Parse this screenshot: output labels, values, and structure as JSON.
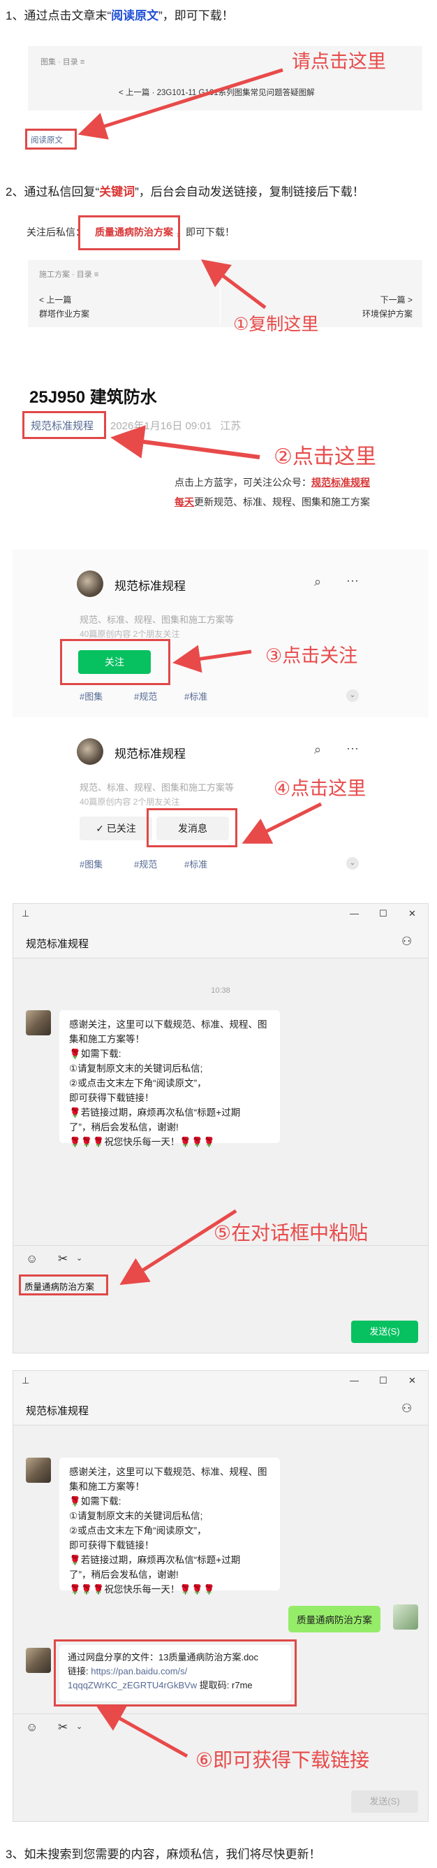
{
  "step1": {
    "prefix": "1、通过点击文章末“",
    "highlight": "阅读原文",
    "suffix": "”，即可下载！"
  },
  "article_footer": {
    "breadcrumb": "图集 · 目录 ≡",
    "prev_label": "< 上一篇 · 23G101-11  G101系列图集常见问题答疑图解",
    "read_original": "阅读原文",
    "callout": "请点击这里"
  },
  "step2": {
    "prefix": "2、通过私信回复“",
    "highlight": "关键词",
    "suffix": "”，后台会自动发送链接，复制链接后下载！"
  },
  "keyword_line": {
    "prefix": "关注后私信：",
    "keyword": "质量通病防治方案",
    "suffix": "，即可下载！"
  },
  "nav_panel": {
    "breadcrumb": "施工方案 · 目录 ≡",
    "prev_label": "< 上一篇",
    "prev_title": "群塔作业方案",
    "next_label": "下一篇 >",
    "next_title": "环境保护方案",
    "callout": "①复制这里"
  },
  "article_header": {
    "title": "25J950 建筑防水",
    "account": "规范标准规程",
    "date": "2026年1月16日 09:01",
    "location": "江苏",
    "callout": "②点击这里",
    "promo_line1_prefix": "点击上方蓝字，可关注公众号：",
    "promo_line1_link": "规范标准规程",
    "promo_line2_highlight": "每天",
    "promo_line2_suffix": "更新规范、标准、规程、图集和施工方案"
  },
  "profile_card_1": {
    "name": "规范标准规程",
    "desc": "规范、标准、规程、图集和施工方案等",
    "stats": "40篇原创内容  2个朋友关注",
    "follow_button": "关注",
    "tags": [
      "#图集",
      "#规范",
      "#标准"
    ],
    "callout": "③点击关注"
  },
  "profile_card_2": {
    "name": "规范标准规程",
    "desc": "规范、标准、规程、图集和施工方案等",
    "stats": "40篇原创内容  2个朋友关注",
    "followed_button": "✓ 已关注",
    "message_button": "发消息",
    "tags": [
      "#图集",
      "#规范",
      "#标准"
    ],
    "callout": "④点击这里"
  },
  "chat_window_1": {
    "title": "规范标准规程",
    "time": "10:38",
    "welcome_lines": [
      "感谢关注，这里可以下载规范、标准、规程、图",
      "集和施工方案等！",
      "🌹如需下载:",
      "      ①请复制原文末的关键词后私信;",
      "      ②或点击文末左下角“阅读原文”，",
      "    即可获得下载链接！",
      "🌹若链接过期，麻烦再次私信“标题+过期",
      "了”，稍后会发私信，谢谢!",
      "🌹🌹🌹祝您快乐每一天！🌹🌹🌹"
    ],
    "input_text": "质量通病防治方案",
    "send_button": "发送(S)",
    "callout": "⑤在对话框中粘贴"
  },
  "chat_window_2": {
    "title": "规范标准规程",
    "welcome_lines": [
      "感谢关注，这里可以下载规范、标准、规程、图",
      "集和施工方案等！",
      "🌹如需下载:",
      "      ①请复制原文末的关键词后私信;",
      "      ②或点击文末左下角“阅读原文”，",
      "    即可获得下载链接！",
      "🌹若链接过期，麻烦再次私信“标题+过期",
      "了”，稍后会发私信，谢谢!",
      "🌹🌹🌹祝您快乐每一天！🌹🌹🌹"
    ],
    "sent_message": "质量通病防治方案",
    "reply_line1": "通过网盘分享的文件：13质量通病防治方案.doc",
    "reply_link_label": "链接: ",
    "reply_link_part1": "https://pan.baidu.com/s/",
    "reply_link_part2": "1qqqZWrKC_zEGRTU4rGkBVw",
    "reply_code": " 提取码: r7me",
    "send_button": "发送(S)",
    "callout": "⑥即可获得下载链接"
  },
  "step3": "3、如未搜索到您需要的内容，麻烦私信，我们将尽快更新！",
  "colors": {
    "accent_red": "#e84a4a",
    "wechat_green": "#07c160",
    "link_blue": "#576b95",
    "bubble_green": "#95ec69"
  }
}
